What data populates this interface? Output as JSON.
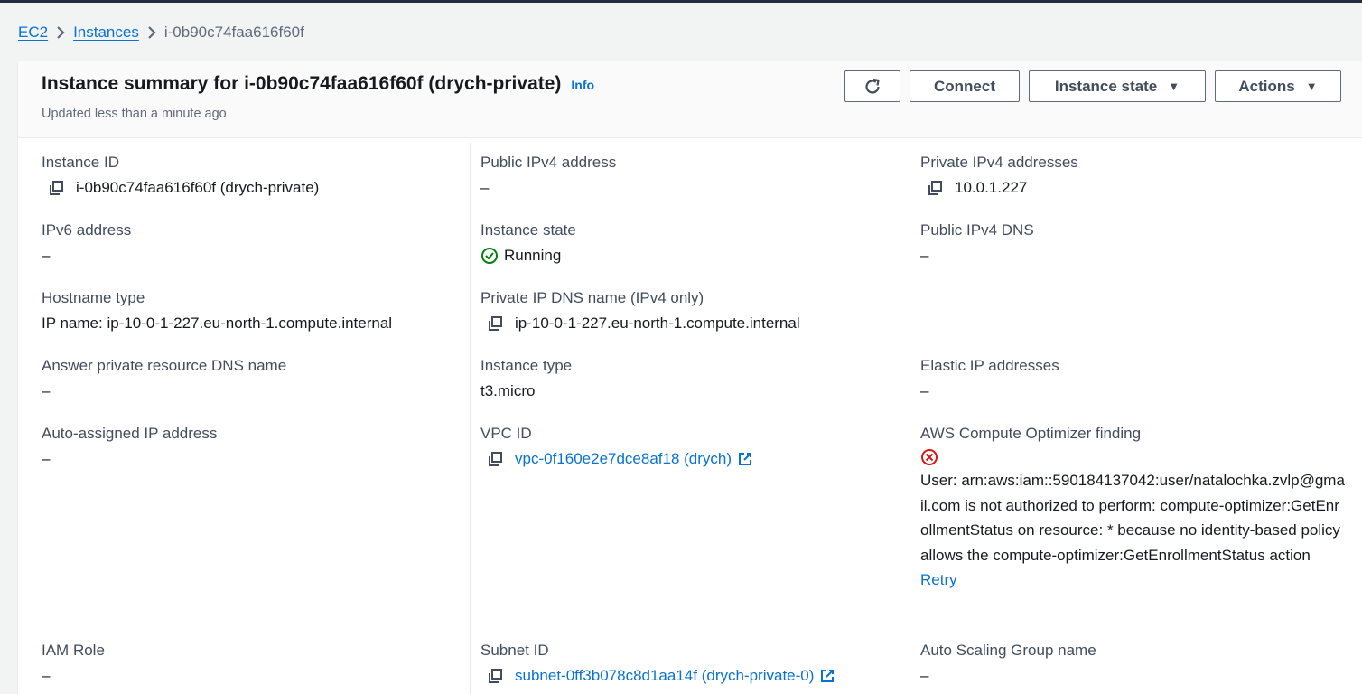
{
  "breadcrumb": {
    "items": [
      "EC2",
      "Instances"
    ],
    "current": "i-0b90c74faa616f60f"
  },
  "header": {
    "title": "Instance summary for i-0b90c74faa616f60f (drych-private)",
    "info": "Info",
    "subtitle": "Updated less than a minute ago"
  },
  "buttons": {
    "refresh_icon": "refresh-icon",
    "connect": "Connect",
    "instance_state": "Instance state",
    "actions": "Actions"
  },
  "fields": {
    "instance_id": {
      "label": "Instance ID",
      "value": "i-0b90c74faa616f60f (drych-private)"
    },
    "public_ipv4": {
      "label": "Public IPv4 address",
      "value": "–"
    },
    "private_ipv4": {
      "label": "Private IPv4 addresses",
      "value": "10.0.1.227"
    },
    "ipv6": {
      "label": "IPv6 address",
      "value": "–"
    },
    "instance_state": {
      "label": "Instance state",
      "value": "Running"
    },
    "public_dns": {
      "label": "Public IPv4 DNS",
      "value": "–"
    },
    "hostname_type": {
      "label": "Hostname type",
      "value": "IP name: ip-10-0-1-227.eu-north-1.compute.internal"
    },
    "private_dns": {
      "label": "Private IP DNS name (IPv4 only)",
      "value": "ip-10-0-1-227.eu-north-1.compute.internal"
    },
    "answer_dns": {
      "label": "Answer private resource DNS name",
      "value": "–"
    },
    "instance_type": {
      "label": "Instance type",
      "value": "t3.micro"
    },
    "elastic_ip": {
      "label": "Elastic IP addresses",
      "value": "–"
    },
    "auto_ip": {
      "label": "Auto-assigned IP address",
      "value": "–"
    },
    "vpc_id": {
      "label": "VPC ID",
      "value": "vpc-0f160e2e7dce8af18 (drych)"
    },
    "optimizer": {
      "label": "AWS Compute Optimizer finding",
      "error": "User: arn:aws:iam::590184137042:user/natalochka.zvlp@gmail.com is not authorized to perform: compute-optimizer:GetEnrollmentStatus on resource: * because no identity-based policy allows the compute-optimizer:GetEnrollmentStatus action",
      "retry": "Retry"
    },
    "iam_role": {
      "label": "IAM Role",
      "value": "–"
    },
    "subnet_id": {
      "label": "Subnet ID",
      "value": "subnet-0ff3b078c8d1aa14f (drych-private-0)"
    },
    "asg_name": {
      "label": "Auto Scaling Group name",
      "value": "–"
    }
  },
  "colors": {
    "link": "#0972d3",
    "success": "#037f0c",
    "error": "#d91515"
  }
}
